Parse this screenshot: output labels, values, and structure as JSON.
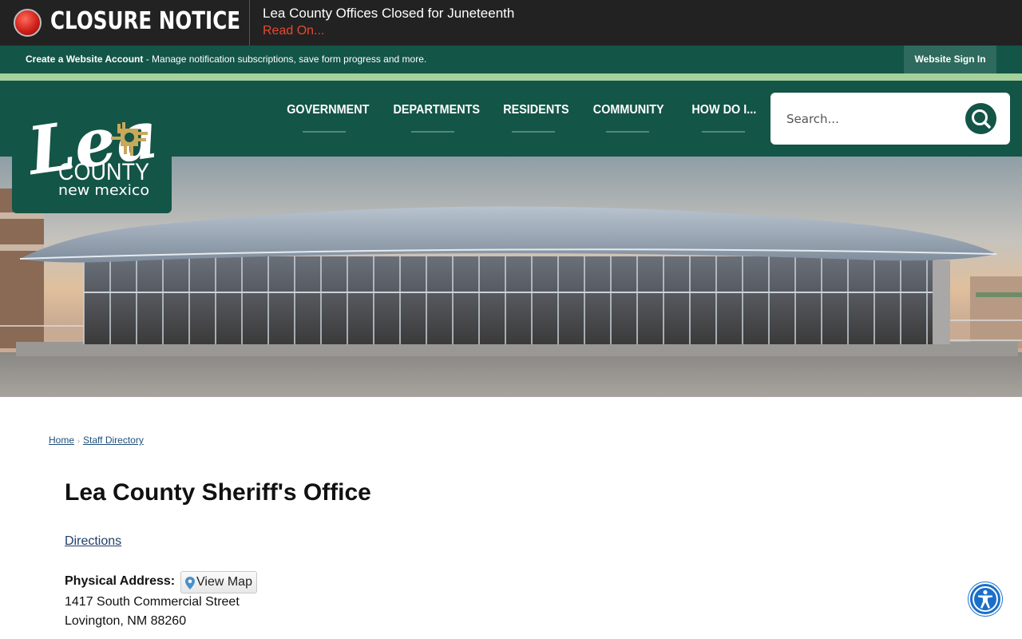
{
  "closure": {
    "title": "CLOSURE NOTICE",
    "headline": "Lea County Offices Closed for Juneteenth",
    "link_text": "Read On..."
  },
  "account_bar": {
    "create_label": "Create a Website Account",
    "create_desc": " - Manage notification subscriptions, save form progress and more.",
    "sign_in": "Website Sign In"
  },
  "logo": {
    "word": "Lea",
    "county": "COUNTY",
    "state": "new mexico"
  },
  "nav": {
    "items": [
      {
        "label": "GOVERNMENT"
      },
      {
        "label": "DEPARTMENTS"
      },
      {
        "label": "RESIDENTS"
      },
      {
        "label": "COMMUNITY"
      },
      {
        "label": "HOW DO I..."
      }
    ]
  },
  "search": {
    "placeholder": "Search..."
  },
  "breadcrumb": {
    "home": "Home",
    "current": "Staff Directory",
    "separator": "›"
  },
  "content": {
    "title": "Lea County Sheriff's Office",
    "directions": "Directions",
    "address_label": "Physical Address:",
    "view_map": "View Map",
    "address_line1": "1417 South Commercial Street",
    "address_line2": "Lovington, NM 88260"
  },
  "colors": {
    "brand_green": "#135547",
    "accent_light_green": "#a6d19c",
    "closure_red": "#e8492f",
    "accessibility_blue": "#1a6fc9"
  },
  "icons": {
    "closure": "alert-dot-icon",
    "search": "search-icon",
    "map_pin": "map-pin-icon",
    "accessibility": "accessibility-icon"
  }
}
